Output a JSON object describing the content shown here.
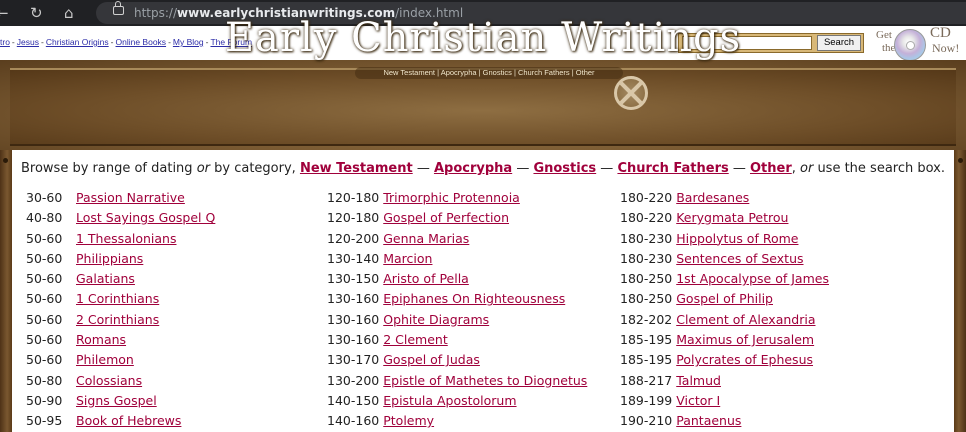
{
  "browser": {
    "url_prefix": "https://",
    "url_domain": "www.earlychristianwritings.com",
    "url_path": "/index.html",
    "back_icon": "back-arrow-icon",
    "reload_icon": "reload-icon",
    "home_icon": "home-icon"
  },
  "toplinks": [
    {
      "label": "tro"
    },
    {
      "label": "Jesus"
    },
    {
      "label": "Christian Origins"
    },
    {
      "label": "Online Books"
    },
    {
      "label": "My Blog"
    },
    {
      "label": "The Forum"
    }
  ],
  "search": {
    "value": "",
    "button_label": "Search"
  },
  "promo": {
    "get": "Get",
    "the": "the",
    "cd": "CD",
    "now": "Now!"
  },
  "banner": {
    "title": "Early Christian Writings",
    "subtitle": "New Testament | Apocrypha | Gnostics | Church Fathers | Other"
  },
  "browse": {
    "lead": "Browse by range of dating ",
    "or1": "or",
    "mid": " by category, ",
    "categories": [
      "New Testament",
      "Apocrypha",
      "Gnostics",
      "Church Fathers",
      "Other"
    ],
    "dash": " — ",
    "comma": ", ",
    "or2": "or",
    "tail": " use the search box."
  },
  "columns": [
    [
      {
        "date": "30-60",
        "title": "Passion Narrative"
      },
      {
        "date": "40-80",
        "title": "Lost Sayings Gospel Q"
      },
      {
        "date": "50-60",
        "title": "1 Thessalonians"
      },
      {
        "date": "50-60",
        "title": "Philippians"
      },
      {
        "date": "50-60",
        "title": "Galatians"
      },
      {
        "date": "50-60",
        "title": "1 Corinthians"
      },
      {
        "date": "50-60",
        "title": "2 Corinthians"
      },
      {
        "date": "50-60",
        "title": "Romans"
      },
      {
        "date": "50-60",
        "title": "Philemon"
      },
      {
        "date": "50-80",
        "title": "Colossians"
      },
      {
        "date": "50-90",
        "title": "Signs Gospel"
      },
      {
        "date": "50-95",
        "title": "Book of Hebrews"
      }
    ],
    [
      {
        "date": "120-180",
        "title": "Trimorphic Protennoia"
      },
      {
        "date": "120-180",
        "title": "Gospel of Perfection"
      },
      {
        "date": "120-200",
        "title": "Genna Marias"
      },
      {
        "date": "130-140",
        "title": "Marcion"
      },
      {
        "date": "130-150",
        "title": "Aristo of Pella"
      },
      {
        "date": "130-160",
        "title": "Epiphanes On Righteousness"
      },
      {
        "date": "130-160",
        "title": "Ophite Diagrams"
      },
      {
        "date": "130-160",
        "title": "2 Clement"
      },
      {
        "date": "130-170",
        "title": "Gospel of Judas"
      },
      {
        "date": "130-200",
        "title": "Epistle of Mathetes to Diognetus"
      },
      {
        "date": "140-150",
        "title": "Epistula Apostolorum"
      },
      {
        "date": "140-160",
        "title": "Ptolemy"
      }
    ],
    [
      {
        "date": "180-220",
        "title": "Bardesanes"
      },
      {
        "date": "180-220",
        "title": "Kerygmata Petrou"
      },
      {
        "date": "180-230",
        "title": "Hippolytus of Rome"
      },
      {
        "date": "180-230",
        "title": "Sentences of Sextus"
      },
      {
        "date": "180-250",
        "title": "1st Apocalypse of James"
      },
      {
        "date": "180-250",
        "title": "Gospel of Philip"
      },
      {
        "date": "182-202",
        "title": "Clement of Alexandria"
      },
      {
        "date": "185-195",
        "title": "Maximus of Jerusalem"
      },
      {
        "date": "185-195",
        "title": "Polycrates of Ephesus"
      },
      {
        "date": "188-217",
        "title": "Talmud"
      },
      {
        "date": "189-199",
        "title": "Victor I"
      },
      {
        "date": "190-210",
        "title": "Pantaenus"
      }
    ]
  ]
}
